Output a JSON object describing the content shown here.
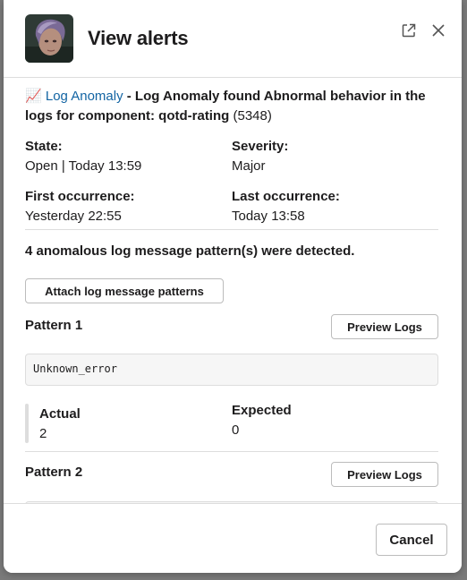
{
  "modal": {
    "title": "View alerts",
    "open_external_icon": "external-link-icon",
    "close_icon": "close-icon"
  },
  "alert": {
    "emoji": "📈",
    "link_text": "Log Anomaly",
    "description": " - Log Anomaly found Abnormal behavior in the logs for component: qotd-rating",
    "id": " (5348)"
  },
  "fields": {
    "state_label": "State:",
    "state_value": "Open | Today 13:59",
    "severity_label": "Severity:",
    "severity_value": "Major",
    "first_label": "First occurrence:",
    "first_value": "Yesterday 22:55",
    "last_label": "Last occurrence:",
    "last_value": "Today 13:58"
  },
  "summary": "4 anomalous log message pattern(s) were detected.",
  "attach_button": "Attach log message patterns",
  "patterns": [
    {
      "title": "Pattern 1",
      "preview_button": "Preview Logs",
      "code": "Unknown_error",
      "actual_label": "Actual",
      "actual_value": "2",
      "expected_label": "Expected",
      "expected_value": "0"
    },
    {
      "title": "Pattern 2",
      "preview_button": "Preview Logs"
    }
  ],
  "footer": {
    "cancel_label": "Cancel"
  }
}
